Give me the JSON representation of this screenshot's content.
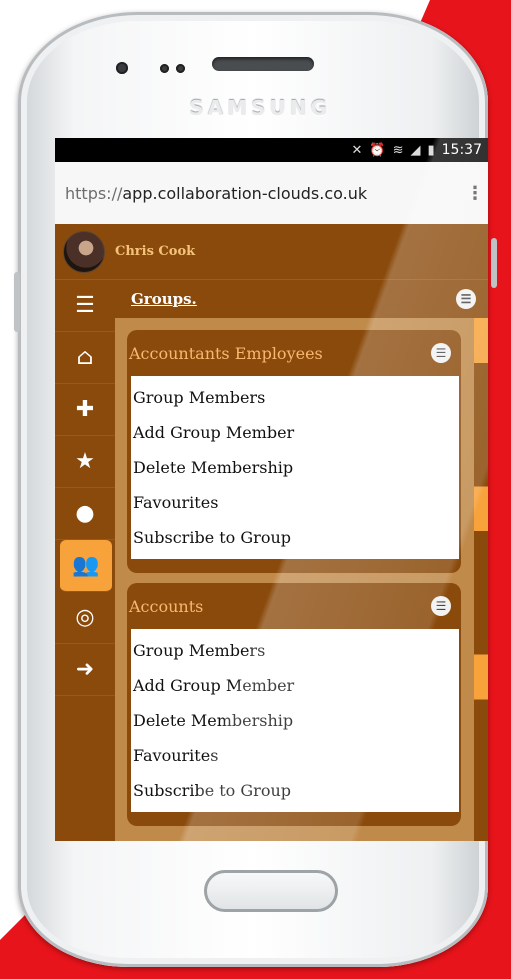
{
  "device": {
    "brand": "SAMSUNG"
  },
  "status_bar": {
    "icons": [
      "mute-icon",
      "alarm-icon",
      "wifi-icon",
      "signal-icon",
      "battery-icon"
    ],
    "time": "15:37"
  },
  "browser": {
    "url_scheme": "https://",
    "url_host": "app.collaboration-clouds.co.uk",
    "menu_icon": "⋮"
  },
  "user": {
    "name": "Chris Cook"
  },
  "sidebar": {
    "items": [
      {
        "icon": "menu-icon",
        "glyph": "☰"
      },
      {
        "icon": "home-icon",
        "glyph": "⌂"
      },
      {
        "icon": "plus-square-icon",
        "glyph": "✚"
      },
      {
        "icon": "star-icon",
        "glyph": "★"
      },
      {
        "icon": "user-icon",
        "glyph": "●"
      },
      {
        "icon": "users-icon",
        "glyph": "👥",
        "active": true
      },
      {
        "icon": "coins-icon",
        "glyph": "◎"
      },
      {
        "icon": "sign-out-icon",
        "glyph": "➜"
      }
    ]
  },
  "section": {
    "title": "Groups."
  },
  "groups": [
    {
      "name": "Accountants Employees",
      "items": [
        "Group Members",
        "Add Group Member",
        "Delete Membership",
        "Favourites",
        "Subscribe to Group"
      ]
    },
    {
      "name": "Accounts",
      "items": [
        "Group Members",
        "Add Group Member",
        "Delete Membership",
        "Favourites",
        "Subscribe to Group"
      ]
    }
  ],
  "colors": {
    "primary_brown": "#8a4a0b",
    "accent_orange": "#f7a23b",
    "group_title": "#f8b871",
    "backdrop_red": "#e8141b"
  }
}
